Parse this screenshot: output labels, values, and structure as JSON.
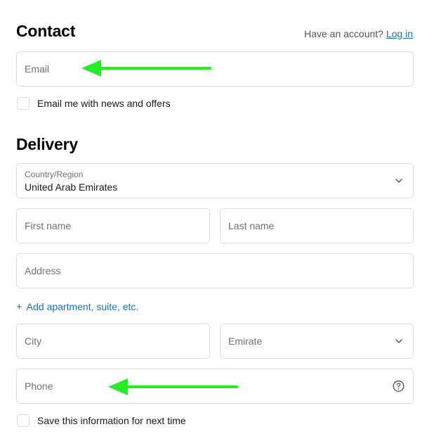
{
  "contact": {
    "title": "Contact",
    "account_prompt": "Have an account?",
    "login_label": "Log in",
    "email_placeholder": "Email",
    "newsletter_label": "Email me with news and offers"
  },
  "delivery": {
    "title": "Delivery",
    "country_label": "Country/Region",
    "country_value": "United Arab Emirates",
    "first_name_placeholder": "First name",
    "last_name_placeholder": "Last name",
    "address_placeholder": "Address",
    "add_apartment_label": "Add apartment, suite, etc.",
    "city_placeholder": "City",
    "emirate_placeholder": "Emirate",
    "phone_placeholder": "Phone",
    "save_info_label": "Save this information for next time"
  },
  "icons": {
    "plus": "plus-icon",
    "chevron": "chevron-down-icon",
    "help": "help-circle-icon",
    "annotation_arrow": "arrow-left-icon"
  },
  "colors": {
    "link": "#1773b0",
    "annotation_arrow": "#22ee22",
    "border": "#dedede",
    "placeholder_text": "#707070"
  }
}
